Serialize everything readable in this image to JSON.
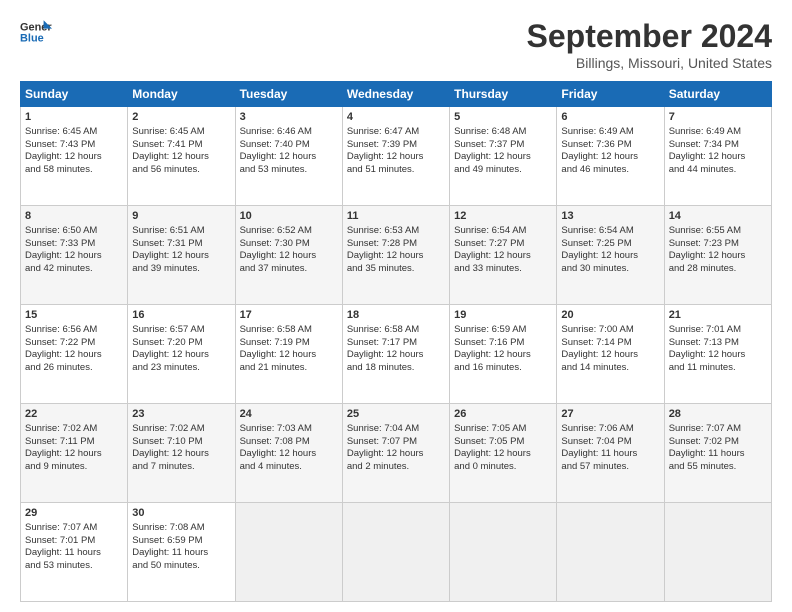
{
  "header": {
    "logo_line1": "General",
    "logo_line2": "Blue",
    "title": "September 2024",
    "subtitle": "Billings, Missouri, United States"
  },
  "columns": [
    "Sunday",
    "Monday",
    "Tuesday",
    "Wednesday",
    "Thursday",
    "Friday",
    "Saturday"
  ],
  "weeks": [
    [
      {
        "day": "1",
        "lines": [
          "Sunrise: 6:45 AM",
          "Sunset: 7:43 PM",
          "Daylight: 12 hours",
          "and 58 minutes."
        ]
      },
      {
        "day": "2",
        "lines": [
          "Sunrise: 6:45 AM",
          "Sunset: 7:41 PM",
          "Daylight: 12 hours",
          "and 56 minutes."
        ]
      },
      {
        "day": "3",
        "lines": [
          "Sunrise: 6:46 AM",
          "Sunset: 7:40 PM",
          "Daylight: 12 hours",
          "and 53 minutes."
        ]
      },
      {
        "day": "4",
        "lines": [
          "Sunrise: 6:47 AM",
          "Sunset: 7:39 PM",
          "Daylight: 12 hours",
          "and 51 minutes."
        ]
      },
      {
        "day": "5",
        "lines": [
          "Sunrise: 6:48 AM",
          "Sunset: 7:37 PM",
          "Daylight: 12 hours",
          "and 49 minutes."
        ]
      },
      {
        "day": "6",
        "lines": [
          "Sunrise: 6:49 AM",
          "Sunset: 7:36 PM",
          "Daylight: 12 hours",
          "and 46 minutes."
        ]
      },
      {
        "day": "7",
        "lines": [
          "Sunrise: 6:49 AM",
          "Sunset: 7:34 PM",
          "Daylight: 12 hours",
          "and 44 minutes."
        ]
      }
    ],
    [
      {
        "day": "8",
        "lines": [
          "Sunrise: 6:50 AM",
          "Sunset: 7:33 PM",
          "Daylight: 12 hours",
          "and 42 minutes."
        ]
      },
      {
        "day": "9",
        "lines": [
          "Sunrise: 6:51 AM",
          "Sunset: 7:31 PM",
          "Daylight: 12 hours",
          "and 39 minutes."
        ]
      },
      {
        "day": "10",
        "lines": [
          "Sunrise: 6:52 AM",
          "Sunset: 7:30 PM",
          "Daylight: 12 hours",
          "and 37 minutes."
        ]
      },
      {
        "day": "11",
        "lines": [
          "Sunrise: 6:53 AM",
          "Sunset: 7:28 PM",
          "Daylight: 12 hours",
          "and 35 minutes."
        ]
      },
      {
        "day": "12",
        "lines": [
          "Sunrise: 6:54 AM",
          "Sunset: 7:27 PM",
          "Daylight: 12 hours",
          "and 33 minutes."
        ]
      },
      {
        "day": "13",
        "lines": [
          "Sunrise: 6:54 AM",
          "Sunset: 7:25 PM",
          "Daylight: 12 hours",
          "and 30 minutes."
        ]
      },
      {
        "day": "14",
        "lines": [
          "Sunrise: 6:55 AM",
          "Sunset: 7:23 PM",
          "Daylight: 12 hours",
          "and 28 minutes."
        ]
      }
    ],
    [
      {
        "day": "15",
        "lines": [
          "Sunrise: 6:56 AM",
          "Sunset: 7:22 PM",
          "Daylight: 12 hours",
          "and 26 minutes."
        ]
      },
      {
        "day": "16",
        "lines": [
          "Sunrise: 6:57 AM",
          "Sunset: 7:20 PM",
          "Daylight: 12 hours",
          "and 23 minutes."
        ]
      },
      {
        "day": "17",
        "lines": [
          "Sunrise: 6:58 AM",
          "Sunset: 7:19 PM",
          "Daylight: 12 hours",
          "and 21 minutes."
        ]
      },
      {
        "day": "18",
        "lines": [
          "Sunrise: 6:58 AM",
          "Sunset: 7:17 PM",
          "Daylight: 12 hours",
          "and 18 minutes."
        ]
      },
      {
        "day": "19",
        "lines": [
          "Sunrise: 6:59 AM",
          "Sunset: 7:16 PM",
          "Daylight: 12 hours",
          "and 16 minutes."
        ]
      },
      {
        "day": "20",
        "lines": [
          "Sunrise: 7:00 AM",
          "Sunset: 7:14 PM",
          "Daylight: 12 hours",
          "and 14 minutes."
        ]
      },
      {
        "day": "21",
        "lines": [
          "Sunrise: 7:01 AM",
          "Sunset: 7:13 PM",
          "Daylight: 12 hours",
          "and 11 minutes."
        ]
      }
    ],
    [
      {
        "day": "22",
        "lines": [
          "Sunrise: 7:02 AM",
          "Sunset: 7:11 PM",
          "Daylight: 12 hours",
          "and 9 minutes."
        ]
      },
      {
        "day": "23",
        "lines": [
          "Sunrise: 7:02 AM",
          "Sunset: 7:10 PM",
          "Daylight: 12 hours",
          "and 7 minutes."
        ]
      },
      {
        "day": "24",
        "lines": [
          "Sunrise: 7:03 AM",
          "Sunset: 7:08 PM",
          "Daylight: 12 hours",
          "and 4 minutes."
        ]
      },
      {
        "day": "25",
        "lines": [
          "Sunrise: 7:04 AM",
          "Sunset: 7:07 PM",
          "Daylight: 12 hours",
          "and 2 minutes."
        ]
      },
      {
        "day": "26",
        "lines": [
          "Sunrise: 7:05 AM",
          "Sunset: 7:05 PM",
          "Daylight: 12 hours",
          "and 0 minutes."
        ]
      },
      {
        "day": "27",
        "lines": [
          "Sunrise: 7:06 AM",
          "Sunset: 7:04 PM",
          "Daylight: 11 hours",
          "and 57 minutes."
        ]
      },
      {
        "day": "28",
        "lines": [
          "Sunrise: 7:07 AM",
          "Sunset: 7:02 PM",
          "Daylight: 11 hours",
          "and 55 minutes."
        ]
      }
    ],
    [
      {
        "day": "29",
        "lines": [
          "Sunrise: 7:07 AM",
          "Sunset: 7:01 PM",
          "Daylight: 11 hours",
          "and 53 minutes."
        ]
      },
      {
        "day": "30",
        "lines": [
          "Sunrise: 7:08 AM",
          "Sunset: 6:59 PM",
          "Daylight: 11 hours",
          "and 50 minutes."
        ]
      },
      null,
      null,
      null,
      null,
      null
    ]
  ]
}
